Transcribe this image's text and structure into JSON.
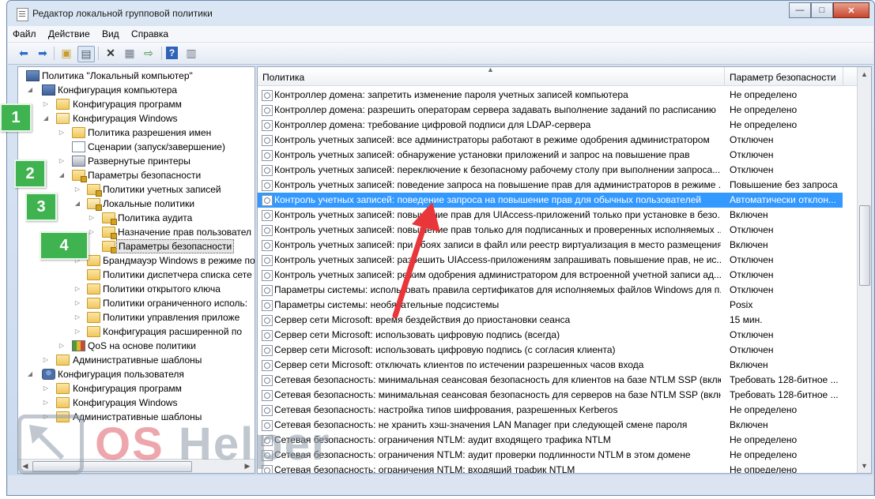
{
  "window": {
    "title": "Редактор локальной групповой политики",
    "controls": {
      "minimize": "—",
      "maximize": "□",
      "close": "✕"
    }
  },
  "menu": [
    "Файл",
    "Действие",
    "Вид",
    "Справка"
  ],
  "toolbar": {
    "icons": [
      "back-icon",
      "forward-icon",
      "up-folder-icon",
      "show-hide-tree-icon",
      "delete-icon",
      "properties-icon",
      "export-icon",
      "help-icon",
      "view-icon"
    ]
  },
  "tree": {
    "items": [
      {
        "label": "Политика \"Локальный компьютер\"",
        "icon": "computer-policy-icon",
        "twisty": ""
      },
      {
        "label": "Конфигурация компьютера",
        "icon": "computer-icon",
        "twisty": "◢"
      },
      {
        "label": "Конфигурация программ",
        "icon": "folder-icon",
        "twisty": "▷"
      },
      {
        "label": "Конфигурация Windows",
        "icon": "folder-icon",
        "twisty": "◢"
      },
      {
        "label": "Политика разрешения имен",
        "icon": "folder-icon",
        "twisty": "▷"
      },
      {
        "label": "Сценарии (запуск/завершение)",
        "icon": "script-icon",
        "twisty": ""
      },
      {
        "label": "Развернутые принтеры",
        "icon": "printer-icon",
        "twisty": "▷"
      },
      {
        "label": "Параметры безопасности",
        "icon": "security-folder-icon",
        "twisty": "◢"
      },
      {
        "label": "Политики учетных записей",
        "icon": "folder-lock-icon",
        "twisty": "▷"
      },
      {
        "label": "Локальные политики",
        "icon": "folder-lock-icon",
        "twisty": "◢"
      },
      {
        "label": "Политика аудита",
        "icon": "folder-lock-icon",
        "twisty": "▷"
      },
      {
        "label": "Назначение прав пользовател",
        "icon": "folder-lock-icon",
        "twisty": "▷"
      },
      {
        "label": "Параметры безопасности",
        "icon": "folder-lock-icon",
        "twisty": "",
        "selected": true
      },
      {
        "label": "Брандмауэр Windows в режиме по",
        "icon": "folder-icon",
        "twisty": "▷"
      },
      {
        "label": "Политики диспетчера списка сете",
        "icon": "folder-icon",
        "twisty": ""
      },
      {
        "label": "Политики открытого ключа",
        "icon": "folder-icon",
        "twisty": "▷"
      },
      {
        "label": "Политики ограниченного исполь:",
        "icon": "folder-icon",
        "twisty": "▷"
      },
      {
        "label": "Политики управления приложе",
        "icon": "folder-icon",
        "twisty": "▷"
      },
      {
        "label": "Конфигурация расширенной по",
        "icon": "folder-icon",
        "twisty": "▷"
      },
      {
        "label": "QoS на основе политики",
        "icon": "qos-icon",
        "twisty": "▷"
      },
      {
        "label": "Административные шаблоны",
        "icon": "folder-icon",
        "twisty": "▷"
      },
      {
        "label": "Конфигурация пользователя",
        "icon": "user-icon",
        "twisty": "◢"
      },
      {
        "label": "Конфигурация программ",
        "icon": "folder-icon",
        "twisty": "▷"
      },
      {
        "label": "Конфигурация Windows",
        "icon": "folder-icon",
        "twisty": "▷"
      },
      {
        "label": "Административные шаблоны",
        "icon": "folder-icon",
        "twisty": "▷"
      }
    ]
  },
  "list": {
    "columns": [
      "Политика",
      "Параметр безопасности"
    ],
    "rows": [
      {
        "policy": "Контроллер домена: запретить изменение пароля учетных записей компьютера",
        "value": "Не определено"
      },
      {
        "policy": "Контроллер домена: разрешить операторам сервера задавать выполнение заданий по расписанию",
        "value": "Не определено"
      },
      {
        "policy": "Контроллер домена: требование цифровой подписи для LDAP-сервера",
        "value": "Не определено"
      },
      {
        "policy": "Контроль учетных записей: все администраторы работают в режиме одобрения администратором",
        "value": "Отключен"
      },
      {
        "policy": "Контроль учетных записей: обнаружение установки приложений и запрос на повышение прав",
        "value": "Отключен"
      },
      {
        "policy": "Контроль учетных записей: переключение к безопасному рабочему столу при выполнении запроса...",
        "value": "Отключен"
      },
      {
        "policy": "Контроль учетных записей: поведение запроса на повышение прав для администраторов в режиме ...",
        "value": "Повышение без запроса"
      },
      {
        "policy": "Контроль учетных записей: поведение запроса на повышение прав для обычных пользователей",
        "value": "Автоматически отклон...",
        "selected": true
      },
      {
        "policy": "Контроль учетных записей: повышение прав для UIAccess-приложений только при установке в безо...",
        "value": "Включен"
      },
      {
        "policy": "Контроль учетных записей: повышение прав только для подписанных и проверенных исполняемых ...",
        "value": "Отключен"
      },
      {
        "policy": "Контроль учетных записей: при сбоях записи в файл или реестр виртуализация в место размещения...",
        "value": "Включен"
      },
      {
        "policy": "Контроль учетных записей: разрешить UIAccess-приложениям запрашивать повышение прав, не ис...",
        "value": "Отключен"
      },
      {
        "policy": "Контроль учетных записей: режим одобрения администратором для встроенной учетной записи ад...",
        "value": "Отключен"
      },
      {
        "policy": "Параметры системы: использовать правила сертификатов для исполняемых файлов Windows для п...",
        "value": "Отключен"
      },
      {
        "policy": "Параметры системы: необязательные подсистемы",
        "value": "Posix"
      },
      {
        "policy": "Сервер сети Microsoft: время бездействия до приостановки сеанса",
        "value": "15 мин."
      },
      {
        "policy": "Сервер сети Microsoft: использовать цифровую подпись (всегда)",
        "value": "Отключен"
      },
      {
        "policy": "Сервер сети Microsoft: использовать цифровую подпись (с согласия клиента)",
        "value": "Отключен"
      },
      {
        "policy": "Сервер сети Microsoft: отключать клиентов по истечении разрешенных часов входа",
        "value": "Включен"
      },
      {
        "policy": "Сетевая безопасность: минимальная сеансовая безопасность для клиентов на базе NTLM SSP (вклю...",
        "value": "Требовать 128-битное ..."
      },
      {
        "policy": "Сетевая безопасность: минимальная сеансовая безопасность для серверов на базе NTLM SSP (вклю...",
        "value": "Требовать 128-битное ..."
      },
      {
        "policy": "Сетевая безопасность: настройка типов шифрования, разрешенных Kerberos",
        "value": "Не определено"
      },
      {
        "policy": "Сетевая безопасность: не хранить хэш-значения LAN Manager при следующей смене пароля",
        "value": "Включен"
      },
      {
        "policy": "Сетевая безопасность: ограничения NTLM: аудит входящего трафика NTLM",
        "value": "Не определено"
      },
      {
        "policy": "Сетевая безопасность: ограничения NTLM: аудит проверки подлинности NTLM в этом домене",
        "value": "Не определено"
      },
      {
        "policy": "Сетевая безопасность: ограничения NTLM: входящий трафик NTLM",
        "value": "Не определено"
      }
    ]
  },
  "annotations": {
    "badges": [
      "1",
      "2",
      "3",
      "4"
    ],
    "arrow_color": "#e8363a",
    "badge_color": "#3fb34f"
  },
  "watermark": {
    "part1": "OS",
    "part2": " Helper"
  }
}
